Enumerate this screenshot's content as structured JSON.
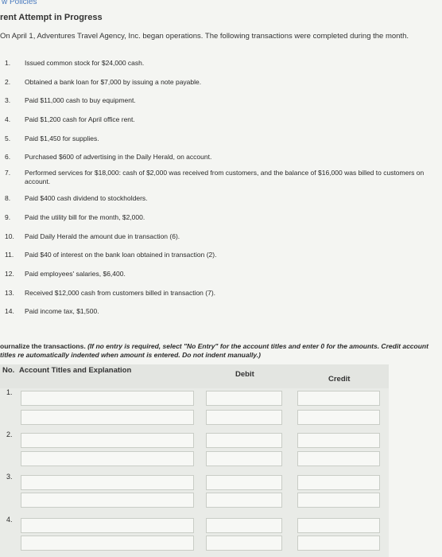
{
  "nav": {
    "policies_link": "w Policies"
  },
  "page": {
    "title": "rent Attempt in Progress",
    "intro": "On April 1, Adventures Travel Agency, Inc. began operations. The following transactions were completed during the month."
  },
  "transactions": [
    {
      "num": "1.",
      "text": "Issued common stock for $24,000 cash."
    },
    {
      "num": "2.",
      "text": "Obtained a bank loan for $7,000 by issuing a note payable."
    },
    {
      "num": "3.",
      "text": "Paid $11,000 cash to buy equipment."
    },
    {
      "num": "4.",
      "text": "Paid $1,200 cash for April office rent."
    },
    {
      "num": "5.",
      "text": "Paid $1,450 for supplies."
    },
    {
      "num": "6.",
      "text": "Purchased $600 of advertising in the Daily Herald, on account."
    },
    {
      "num": "7.",
      "text": "Performed services for $18,000: cash of $2,000 was received from customers, and the balance of $16,000 was billed to customers on account."
    },
    {
      "num": "8.",
      "text": "Paid $400 cash dividend to stockholders."
    },
    {
      "num": "9.",
      "text": "Paid the utility bill for the month, $2,000."
    },
    {
      "num": "10.",
      "text": "Paid Daily Herald the amount due in transaction (6)."
    },
    {
      "num": "11.",
      "text": "Paid $40 of interest on the bank loan obtained in transaction (2)."
    },
    {
      "num": "12.",
      "text": "Paid employees' salaries, $6,400."
    },
    {
      "num": "13.",
      "text": "Received $12,000 cash from customers billed in transaction (7)."
    },
    {
      "num": "14.",
      "text": "Paid income tax, $1,500."
    }
  ],
  "instructions": {
    "lead": "ournalize the transactions. ",
    "italic": "(If no entry is required, select \"No Entry\" for the account titles and enter 0 for the amounts. Credit account titles re automatically indented when amount is entered. Do not indent manually.)"
  },
  "table": {
    "col_no": "No.",
    "col_account": "Account Titles and Explanation",
    "col_debit": "Debit",
    "col_credit": "Credit",
    "rows": [
      {
        "num": "1.",
        "account": "",
        "debit": "",
        "credit": ""
      },
      {
        "num": "",
        "account": "",
        "debit": "",
        "credit": ""
      },
      {
        "num": "2.",
        "account": "",
        "debit": "",
        "credit": ""
      },
      {
        "num": "",
        "account": "",
        "debit": "",
        "credit": ""
      },
      {
        "num": "3.",
        "account": "",
        "debit": "",
        "credit": ""
      },
      {
        "num": "",
        "account": "",
        "debit": "",
        "credit": ""
      },
      {
        "num": "4.",
        "account": "",
        "debit": "",
        "credit": ""
      },
      {
        "num": "",
        "account": "",
        "debit": "",
        "credit": ""
      }
    ]
  }
}
